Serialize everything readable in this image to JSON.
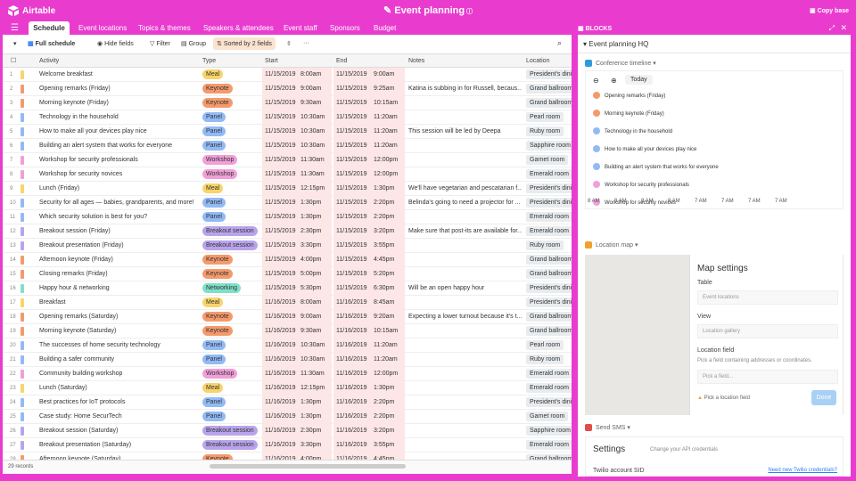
{
  "app": {
    "logo_text": "Airtable",
    "base_title": "Event planning",
    "copy_base": "Copy base",
    "blocks_label": "BLOCKS"
  },
  "tabs": [
    "Schedule",
    "Event locations",
    "Topics & themes",
    "Speakers & attendees",
    "Event staff",
    "Sponsors",
    "Budget"
  ],
  "toolbar": {
    "view_name": "Full schedule",
    "hide_fields": "Hide fields",
    "filter": "Filter",
    "group": "Group",
    "sorted": "Sorted by 2 fields",
    "more": "···"
  },
  "columns": [
    "Activity",
    "Type",
    "Start",
    "End",
    "Notes",
    "Location"
  ],
  "type_colors": {
    "Meal": "#f8d46b",
    "Keynote": "#f59a6c",
    "Panel": "#92baf5",
    "Workshop": "#f19fd8",
    "Breakout session": "#b9a4ec",
    "Networking": "#7fe0c8"
  },
  "rows": [
    {
      "n": "1",
      "activity": "Welcome breakfast",
      "type": "Meal",
      "sd": "11/15/2019",
      "st": "8:00am",
      "ed": "11/15/2019",
      "et": "9:00am",
      "notes": "",
      "loc": "President's dinin"
    },
    {
      "n": "2",
      "activity": "Opening remarks (Friday)",
      "type": "Keynote",
      "sd": "11/15/2019",
      "st": "9:00am",
      "ed": "11/15/2019",
      "et": "9:25am",
      "notes": "Katina is subbing in for Russell, becaus...",
      "loc": "Grand ballroom"
    },
    {
      "n": "3",
      "activity": "Morning keynote (Friday)",
      "type": "Keynote",
      "sd": "11/15/2019",
      "st": "9:30am",
      "ed": "11/15/2019",
      "et": "10:15am",
      "notes": "",
      "loc": "Grand ballroom"
    },
    {
      "n": "4",
      "activity": "Technology in the household",
      "type": "Panel",
      "sd": "11/15/2019",
      "st": "10:30am",
      "ed": "11/15/2019",
      "et": "11:20am",
      "notes": "",
      "loc": "Pearl room"
    },
    {
      "n": "5",
      "activity": "How to make all your devices play nice",
      "type": "Panel",
      "sd": "11/15/2019",
      "st": "10:30am",
      "ed": "11/15/2019",
      "et": "11:20am",
      "notes": "This session will be led by Deepa",
      "loc": "Ruby room"
    },
    {
      "n": "6",
      "activity": "Building an alert system that works for everyone",
      "type": "Panel",
      "sd": "11/15/2019",
      "st": "10:30am",
      "ed": "11/15/2019",
      "et": "11:20am",
      "notes": "",
      "loc": "Sapphire room"
    },
    {
      "n": "7",
      "activity": "Workshop for security professionals",
      "type": "Workshop",
      "sd": "11/15/2019",
      "st": "11:30am",
      "ed": "11/15/2019",
      "et": "12:00pm",
      "notes": "",
      "loc": "Garnet room"
    },
    {
      "n": "8",
      "activity": "Workshop for security novices",
      "type": "Workshop",
      "sd": "11/15/2019",
      "st": "11:30am",
      "ed": "11/15/2019",
      "et": "12:00pm",
      "notes": "",
      "loc": "Emerald room"
    },
    {
      "n": "9",
      "activity": "Lunch (Friday)",
      "type": "Meal",
      "sd": "11/15/2019",
      "st": "12:15pm",
      "ed": "11/15/2019",
      "et": "1:30pm",
      "notes": "We'll have vegetarian and pescatarian f...",
      "loc": "President's dinin"
    },
    {
      "n": "10",
      "activity": "Security for all ages — babies, grandparents, and more!",
      "type": "Panel",
      "sd": "11/15/2019",
      "st": "1:30pm",
      "ed": "11/15/2019",
      "et": "2:20pm",
      "notes": "Belinda's going to need a projector for ...",
      "loc": "President's dinin"
    },
    {
      "n": "11",
      "activity": "Which security solution is best for you?",
      "type": "Panel",
      "sd": "11/15/2019",
      "st": "1:30pm",
      "ed": "11/15/2019",
      "et": "2:20pm",
      "notes": "",
      "loc": "Emerald room"
    },
    {
      "n": "12",
      "activity": "Breakout session (Friday)",
      "type": "Breakout session",
      "sd": "11/15/2019",
      "st": "2:30pm",
      "ed": "11/15/2019",
      "et": "3:20pm",
      "notes": "Make sure that post-its are available for...",
      "loc": "Emerald room"
    },
    {
      "n": "13",
      "activity": "Breakout presentation (Friday)",
      "type": "Breakout session",
      "sd": "11/15/2019",
      "st": "3:30pm",
      "ed": "11/15/2019",
      "et": "3:55pm",
      "notes": "",
      "loc": "Ruby room"
    },
    {
      "n": "14",
      "activity": "Afternoon keynote (Friday)",
      "type": "Keynote",
      "sd": "11/15/2019",
      "st": "4:00pm",
      "ed": "11/15/2019",
      "et": "4:45pm",
      "notes": "",
      "loc": "Grand ballroom"
    },
    {
      "n": "15",
      "activity": "Closing remarks (Friday)",
      "type": "Keynote",
      "sd": "11/15/2019",
      "st": "5:00pm",
      "ed": "11/15/2019",
      "et": "5:20pm",
      "notes": "",
      "loc": "Grand ballroom"
    },
    {
      "n": "16",
      "activity": "Happy hour & networking",
      "type": "Networking",
      "sd": "11/15/2019",
      "st": "5:30pm",
      "ed": "11/15/2019",
      "et": "6:30pm",
      "notes": "Will be an open happy hour",
      "loc": "President's dinin"
    },
    {
      "n": "17",
      "activity": "Breakfast",
      "type": "Meal",
      "sd": "11/16/2019",
      "st": "8:00am",
      "ed": "11/16/2019",
      "et": "8:45am",
      "notes": "",
      "loc": "President's dinin"
    },
    {
      "n": "18",
      "activity": "Opening remarks (Saturday)",
      "type": "Keynote",
      "sd": "11/16/2019",
      "st": "9:00am",
      "ed": "11/16/2019",
      "et": "9:20am",
      "notes": "Expecting a lower turnout because it's t...",
      "loc": "Grand ballroom"
    },
    {
      "n": "19",
      "activity": "Morning keynote (Saturday)",
      "type": "Keynote",
      "sd": "11/16/2019",
      "st": "9:30am",
      "ed": "11/16/2019",
      "et": "10:15am",
      "notes": "",
      "loc": "Grand ballroom"
    },
    {
      "n": "20",
      "activity": "The successes of home security technology",
      "type": "Panel",
      "sd": "11/16/2019",
      "st": "10:30am",
      "ed": "11/16/2019",
      "et": "11:20am",
      "notes": "",
      "loc": "Pearl room"
    },
    {
      "n": "21",
      "activity": "Building a safer community",
      "type": "Panel",
      "sd": "11/16/2019",
      "st": "10:30am",
      "ed": "11/16/2019",
      "et": "11:20am",
      "notes": "",
      "loc": "Ruby room"
    },
    {
      "n": "22",
      "activity": "Community building workshop",
      "type": "Workshop",
      "sd": "11/16/2019",
      "st": "11:30am",
      "ed": "11/16/2019",
      "et": "12:00pm",
      "notes": "",
      "loc": "Emerald room"
    },
    {
      "n": "23",
      "activity": "Lunch (Saturday)",
      "type": "Meal",
      "sd": "11/16/2019",
      "st": "12:15pm",
      "ed": "11/16/2019",
      "et": "1:30pm",
      "notes": "",
      "loc": "Emerald room"
    },
    {
      "n": "24",
      "activity": "Best practices for IoT protocols",
      "type": "Panel",
      "sd": "11/16/2019",
      "st": "1:30pm",
      "ed": "11/16/2019",
      "et": "2:20pm",
      "notes": "",
      "loc": "President's dinin"
    },
    {
      "n": "25",
      "activity": "Case study: Home SecurTech",
      "type": "Panel",
      "sd": "11/16/2019",
      "st": "1:30pm",
      "ed": "11/16/2019",
      "et": "2:20pm",
      "notes": "",
      "loc": "Garnet room"
    },
    {
      "n": "26",
      "activity": "Breakout session (Saturday)",
      "type": "Breakout session",
      "sd": "11/16/2019",
      "st": "2:30pm",
      "ed": "11/16/2019",
      "et": "3:20pm",
      "notes": "",
      "loc": "Sapphire room"
    },
    {
      "n": "27",
      "activity": "Breakout presentation (Saturday)",
      "type": "Breakout session",
      "sd": "11/16/2019",
      "st": "3:30pm",
      "ed": "11/16/2019",
      "et": "3:55pm",
      "notes": "",
      "loc": "Emerald room"
    },
    {
      "n": "28",
      "activity": "Afternoon keynote (Saturday)",
      "type": "Keynote",
      "sd": "11/16/2019",
      "st": "4:00pm",
      "ed": "11/16/2019",
      "et": "4:45pm",
      "notes": "",
      "loc": "Grand ballroom"
    }
  ],
  "footer": {
    "records": "29 records"
  },
  "panel": {
    "title": "Event planning HQ",
    "timeline": {
      "title": "Conference timeline",
      "today": "Today",
      "items": [
        {
          "label": "Opening remarks (Friday)",
          "color": "#f59a6c"
        },
        {
          "label": "Morning keynote (Friday)",
          "color": "#f59a6c"
        },
        {
          "label": "Technology in the household",
          "color": "#92baf5"
        },
        {
          "label": "How to make all your devices play nice",
          "color": "#92baf5"
        },
        {
          "label": "Building an alert system that works for everyone",
          "color": "#92baf5"
        },
        {
          "label": "Workshop for security professionals",
          "color": "#f19fd8"
        },
        {
          "label": "Workshop for security novices",
          "color": "#f19fd8"
        }
      ],
      "axis": [
        "8 AM",
        "8 AM",
        "8 AM",
        "8 AM",
        "7 AM",
        "7 AM",
        "7 AM",
        "7 AM"
      ]
    },
    "map": {
      "title": "Location map",
      "settings_title": "Map settings",
      "table_label": "Table",
      "table_value": "Event locations",
      "view_label": "View",
      "view_value": "Location gallery",
      "field_label": "Location field",
      "field_help": "Pick a field containing addresses or coordinates.",
      "field_value": "Pick a field...",
      "warning": "Pick a location field",
      "done": "Done"
    },
    "sms": {
      "title": "Send SMS",
      "settings": "Settings",
      "change": "Change your API credentials",
      "sid": "Twilio account SID",
      "link": "Need new Twilio credentials?"
    }
  }
}
